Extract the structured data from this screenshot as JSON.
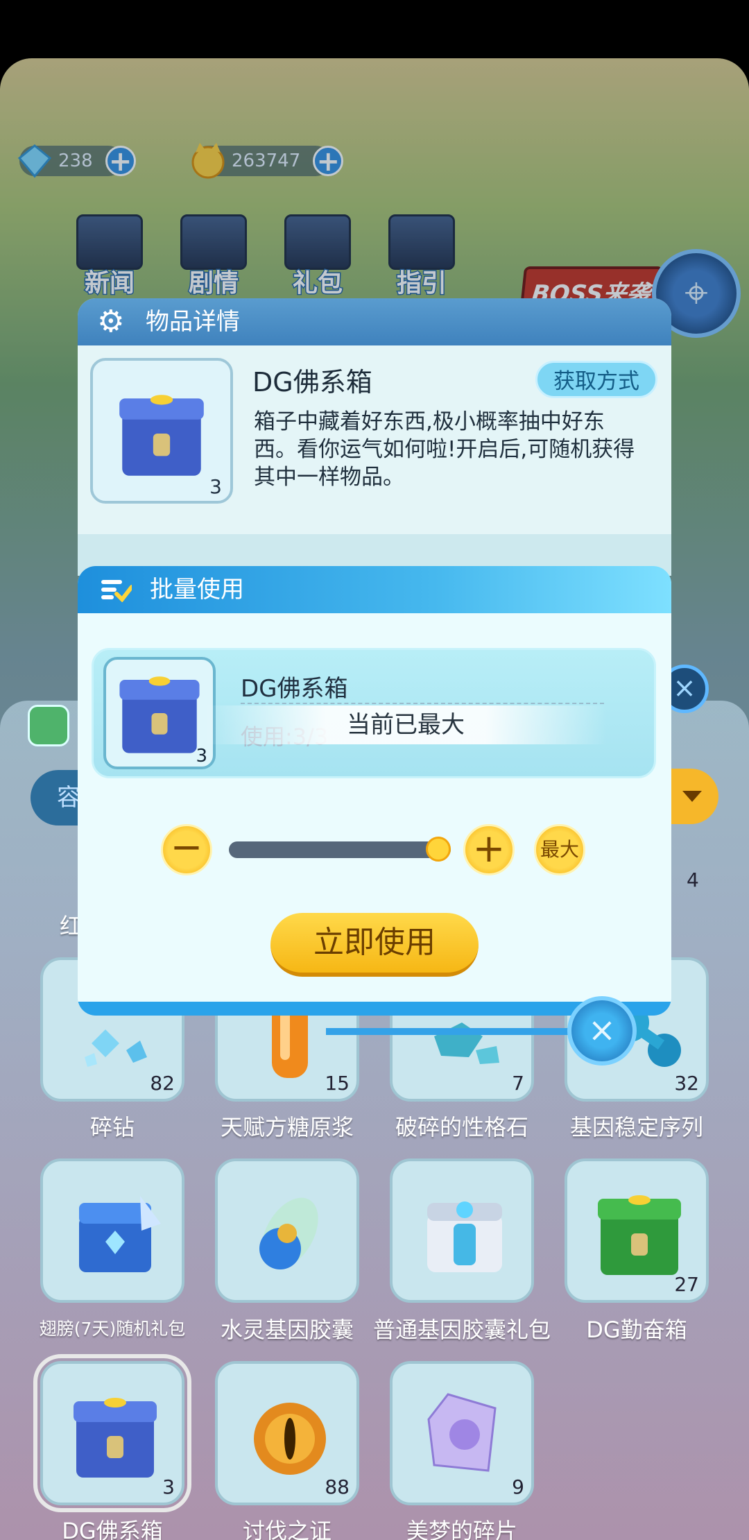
{
  "currency": {
    "gems": "238",
    "coins": "263747"
  },
  "top_menu": [
    {
      "label": "新闻"
    },
    {
      "label": "剧情"
    },
    {
      "label": "礼包"
    },
    {
      "label": "指引"
    }
  ],
  "boss_banner": "BOSS来袭",
  "inventory": {
    "search_prefix": "容",
    "items": [
      {
        "name": "碎钻",
        "count": "82"
      },
      {
        "name": "天赋方糖原浆",
        "count": "15"
      },
      {
        "name": "破碎的性格石",
        "count": "7"
      },
      {
        "name": "基因稳定序列",
        "count": "32"
      },
      {
        "name": "翅膀(7天)随机礼包",
        "count": ""
      },
      {
        "name": "水灵基因胶囊",
        "count": ""
      },
      {
        "name": "普通基因胶囊礼包",
        "count": ""
      },
      {
        "name": "DG勤奋箱",
        "count": "27"
      },
      {
        "name": "DG佛系箱",
        "count": "3"
      },
      {
        "name": "讨伐之证",
        "count": "88"
      },
      {
        "name": "美梦的碎片",
        "count": "9"
      }
    ],
    "partial_label": "红",
    "partial_count": "4"
  },
  "detail": {
    "header": "物品详情",
    "title": "DG佛系箱",
    "count": "3",
    "obtain_button": "获取方式",
    "description": "箱子中藏着好东西,极小概率抽中好东西。看你运气如何啦!开启后,可随机获得其中一样物品。"
  },
  "batch": {
    "header": "批量使用",
    "item_name": "DG佛系箱",
    "item_count": "3",
    "usage_label": "使用:3/3",
    "toast": "当前已最大",
    "minus_label": "−",
    "plus_label": "+",
    "max_label": "最大",
    "use_button": "立即使用",
    "slider_fraction": 1.0
  },
  "colors": {
    "accent_yellow": "#ffd84a",
    "header_blue": "#3f82bd",
    "dialog_bg": "#ebfcfe"
  }
}
